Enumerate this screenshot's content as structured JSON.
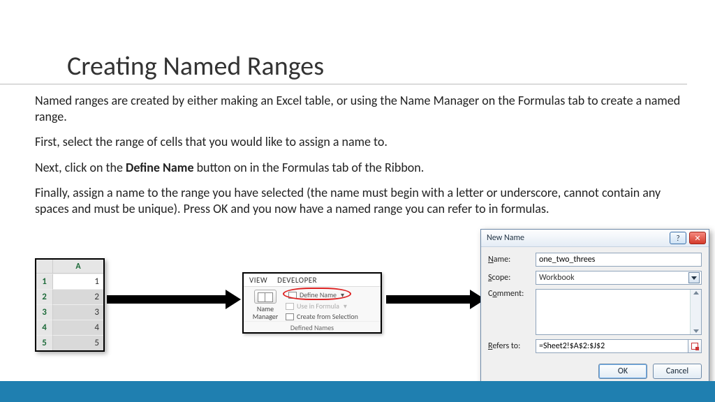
{
  "title": "Creating Named Ranges",
  "para1": "Named ranges are created by either making an Excel table, or using the Name Manager on the Formulas tab to create a named range.",
  "para2": "First, select the range of cells that you would like to assign a name to.",
  "para3a": "Next, click on the ",
  "para3b": "Define Name",
  "para3c": " button on in the Formulas tab of the Ribbon.",
  "para4": "Finally, assign a name to the range you have selected (the name must begin with a letter or underscore, cannot contain any spaces and must be unique). Press OK and you now have a named range you can refer to in formulas.",
  "excel": {
    "col_header": "A",
    "rows": [
      "1",
      "2",
      "3",
      "4",
      "5"
    ],
    "values": [
      "1",
      "2",
      "3",
      "4",
      "5"
    ]
  },
  "ribbon": {
    "tab_view": "VIEW",
    "tab_developer": "DEVELOPER",
    "name_manager": "Name\nManager",
    "define_name": "Define Name",
    "use_in_formula": "Use in Formula",
    "create_from_selection": "Create from Selection",
    "group_label": "Defined Names"
  },
  "dialog": {
    "title": "New Name",
    "lbl_name": "Name:",
    "lbl_scope": "Scope:",
    "lbl_comment": "Comment:",
    "lbl_refers": "Refers to:",
    "name_value": "one_two_threes",
    "scope_value": "Workbook",
    "refers_value": "=Sheet2!$A$2:$J$2",
    "ok": "OK",
    "cancel": "Cancel"
  }
}
